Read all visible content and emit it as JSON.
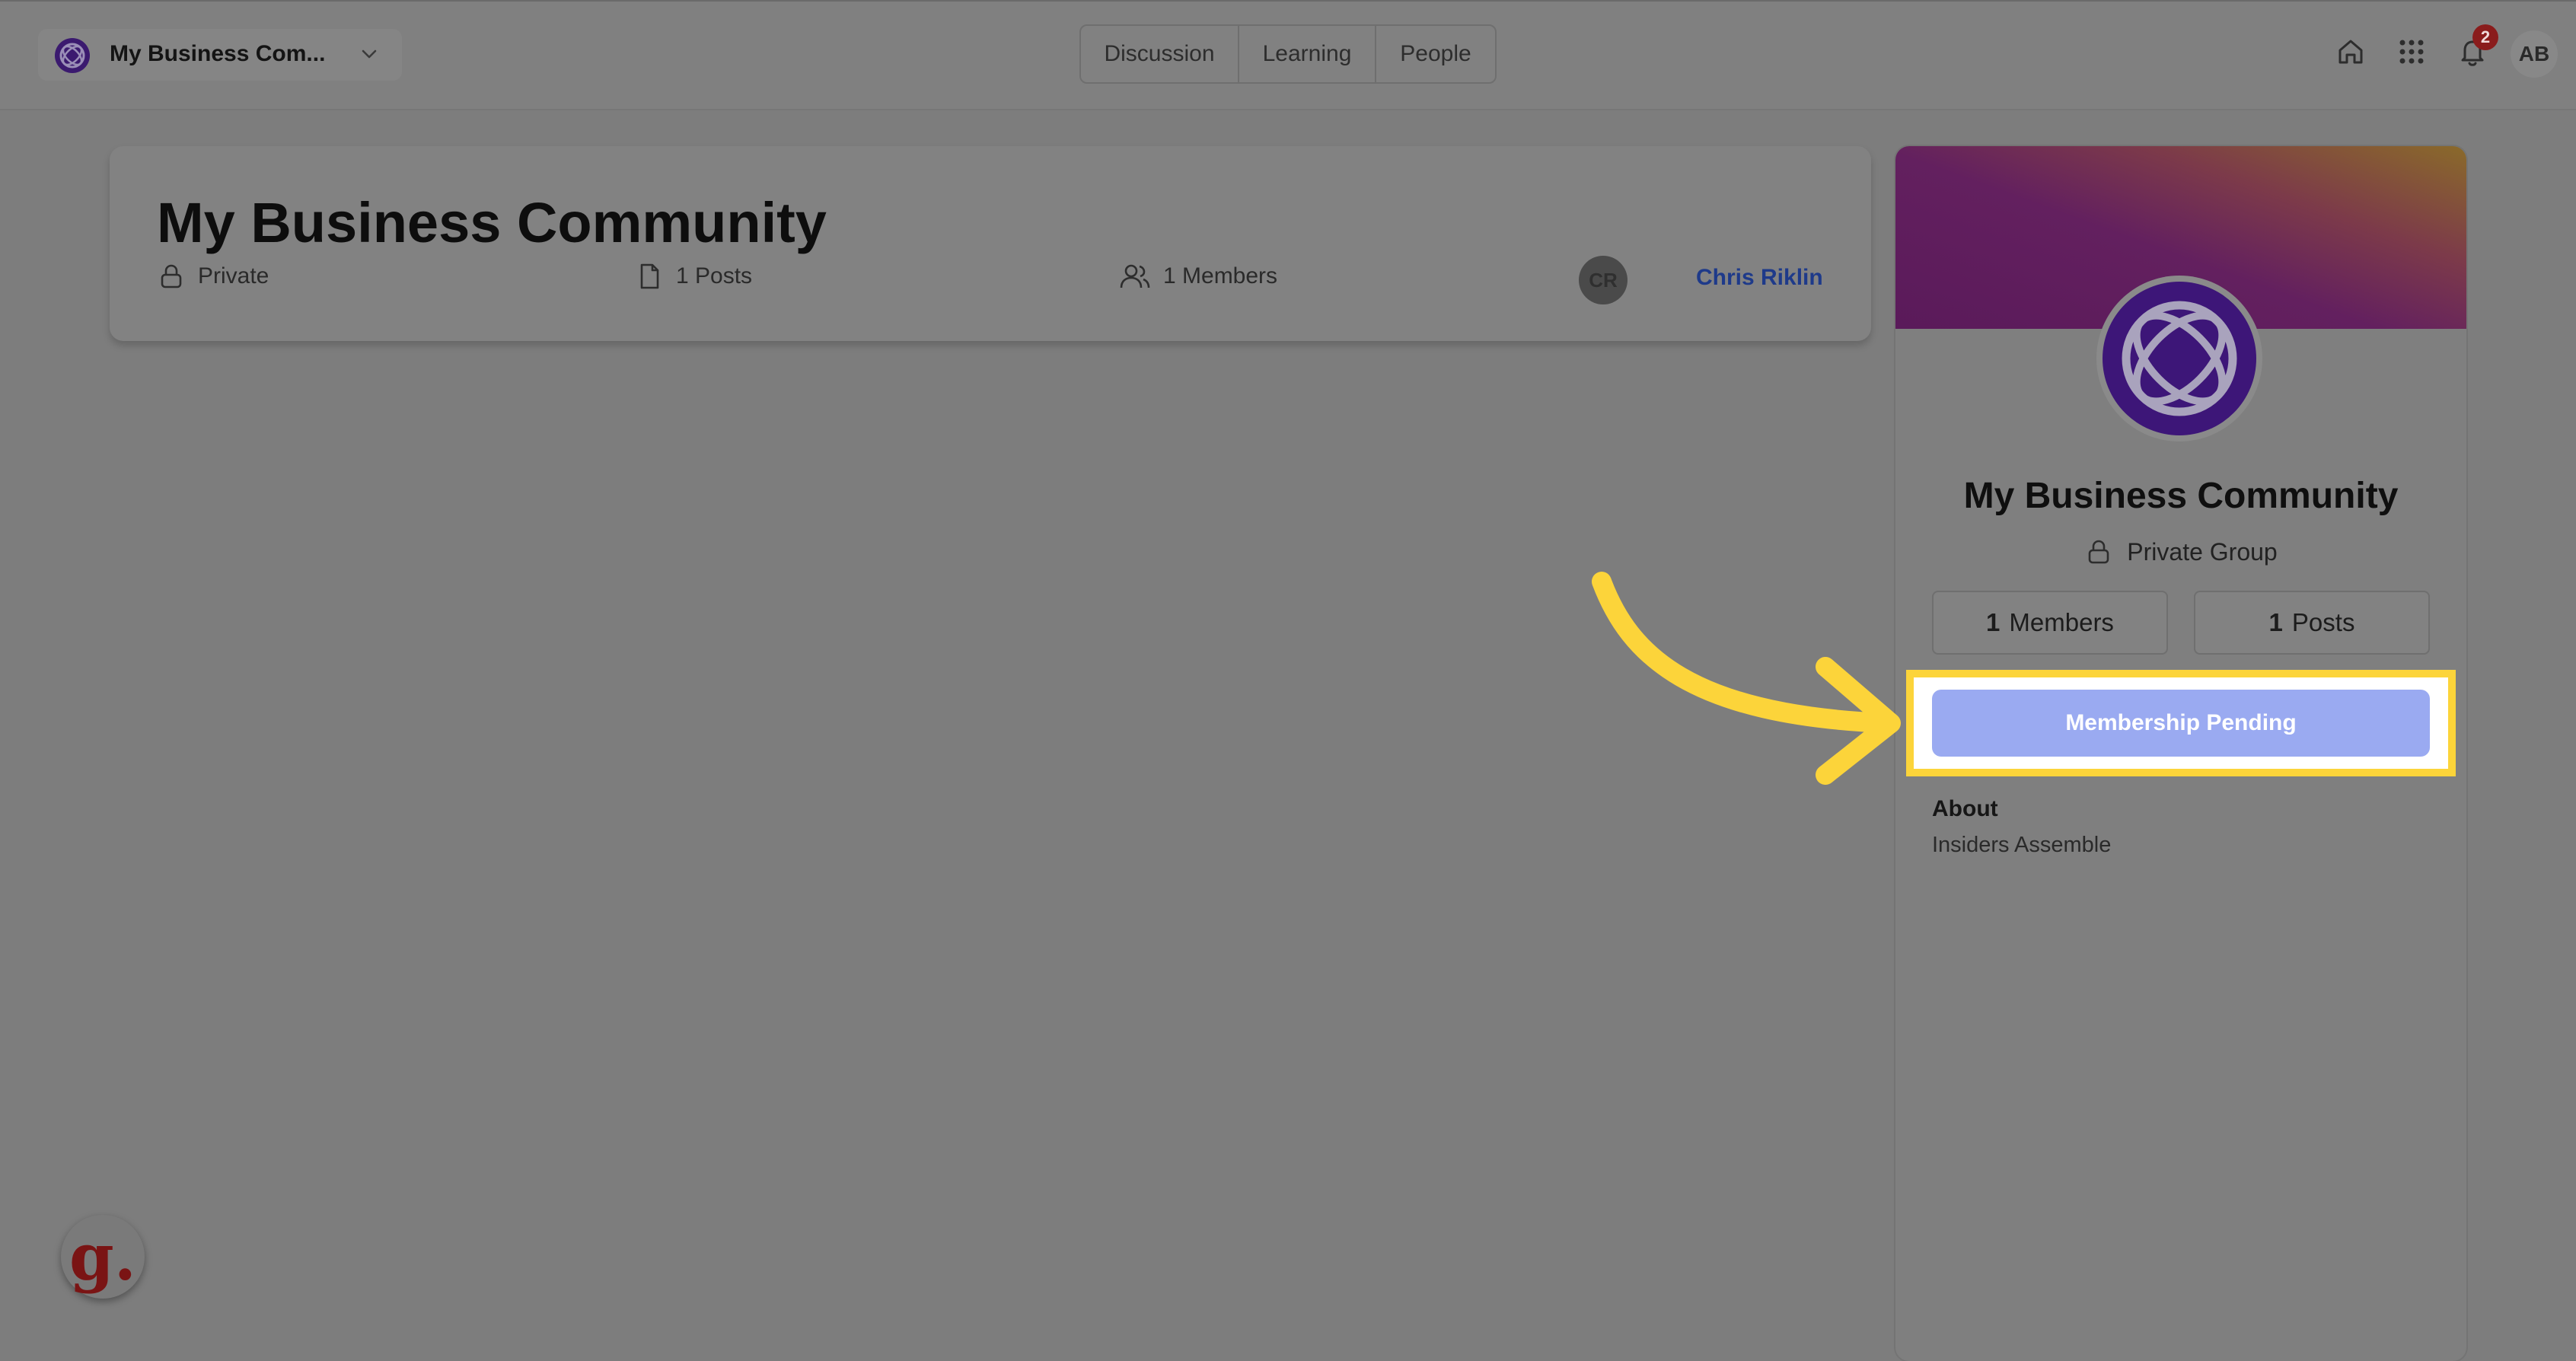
{
  "topbar": {
    "community_name": "My Business Com...",
    "tabs": [
      {
        "label": "Discussion"
      },
      {
        "label": "Learning"
      },
      {
        "label": "People"
      }
    ],
    "notification_count": "2",
    "user_initials": "AB"
  },
  "header": {
    "title": "My Business Community",
    "privacy": "Private",
    "posts": "1 Posts",
    "members": "1 Members",
    "owner_initials": "CR",
    "owner_name": "Chris Riklin"
  },
  "sidebar": {
    "title": "My Business Community",
    "privacy": "Private Group",
    "members_count": "1",
    "members_label": "Members",
    "posts_count": "1",
    "posts_label": "Posts",
    "action_button": "Membership Pending",
    "about_heading": "About",
    "about_text": "Insiders Assemble"
  },
  "widget": {
    "letter": "g."
  },
  "colors": {
    "highlight": "#fcd43a",
    "arrow": "#fcd43a",
    "button": "#9aaaf1",
    "owner_link": "#1e3a8a",
    "badge": "#8a1c1c"
  }
}
